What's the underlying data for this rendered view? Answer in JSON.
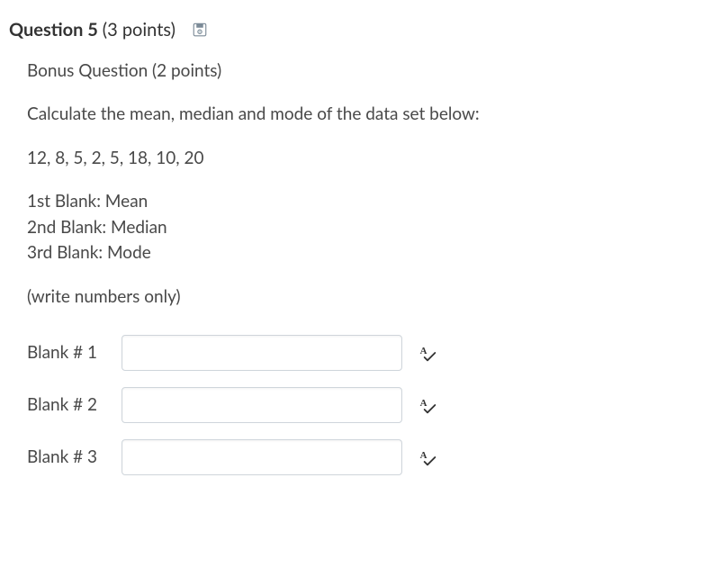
{
  "header": {
    "title": "Question 5",
    "points": "(3 points)"
  },
  "body": {
    "bonusLine": "Bonus Question (2 points)",
    "prompt": "Calculate the mean, median and mode of the data set below:",
    "dataSet": "12, 8, 5, 2, 5, 18, 10, 20",
    "legend": {
      "first": "1st Blank:  Mean",
      "second": "2nd Blank:  Median",
      "third": "3rd Blank:  Mode"
    },
    "hint": "(write numbers only)"
  },
  "blanks": [
    {
      "label": "Blank # 1",
      "value": ""
    },
    {
      "label": "Blank # 2",
      "value": ""
    },
    {
      "label": "Blank # 3",
      "value": ""
    }
  ]
}
